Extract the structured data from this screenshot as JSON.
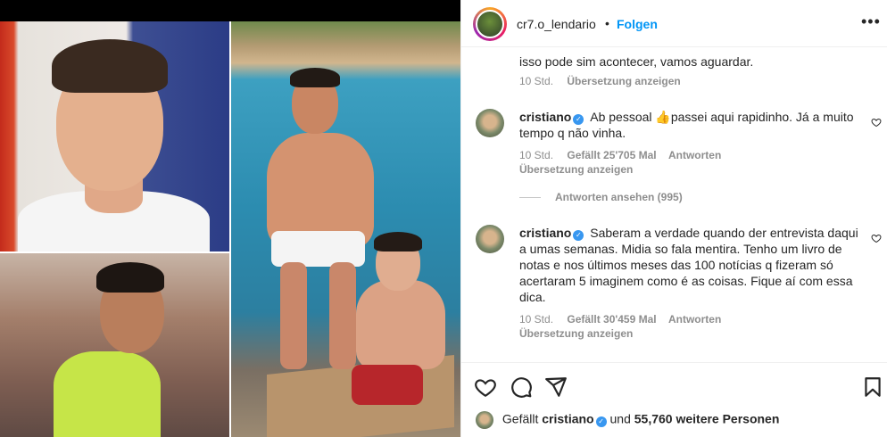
{
  "post": {
    "username": "cr7.o_lendario",
    "separator": "•",
    "follow_label": "Folgen",
    "more_label": "•••"
  },
  "comments": [
    {
      "id": "c0",
      "partial_text": "isso pode sim acontecer, vamos aguardar.",
      "time": "10 Std.",
      "translate": "Übersetzung anzeigen"
    },
    {
      "id": "c1",
      "author": "cristiano",
      "lines": [
        "Ab pessoal 👍passei aqui rapidinho. Já a muito",
        "tempo q não vinha."
      ],
      "time": "10 Std.",
      "likes": "Gefällt 25'705 Mal",
      "reply": "Antworten",
      "translate": "Übersetzung anzeigen"
    },
    {
      "id": "c2",
      "author": "cristiano",
      "lines": [
        "Saberam a verdade quando der entrevista daqui",
        "a umas semanas. Midia so fala mentira. Tenho um livro de",
        "notas e nos últimos meses das 100 notícias q fizeram só",
        "acertaram 5 imaginem como é as coisas. Fique aí com essa",
        "dica."
      ],
      "time": "10 Std.",
      "likes": "Gefällt 30'459 Mal",
      "reply": "Antworten",
      "translate": "Übersetzung anzeigen"
    }
  ],
  "view_replies": "Antworten ansehen (995)",
  "likes_summary": {
    "prefix": "Gefällt",
    "user": "cristiano",
    "middle": "und",
    "others": "55,760 weitere Personen"
  },
  "colors": {
    "accent": "#0095f6",
    "muted": "#8e8e8e",
    "verified": "#3897f0"
  },
  "icons": [
    "heart-icon",
    "comment-icon",
    "share-icon",
    "bookmark-icon",
    "more-icon",
    "verified-icon"
  ]
}
